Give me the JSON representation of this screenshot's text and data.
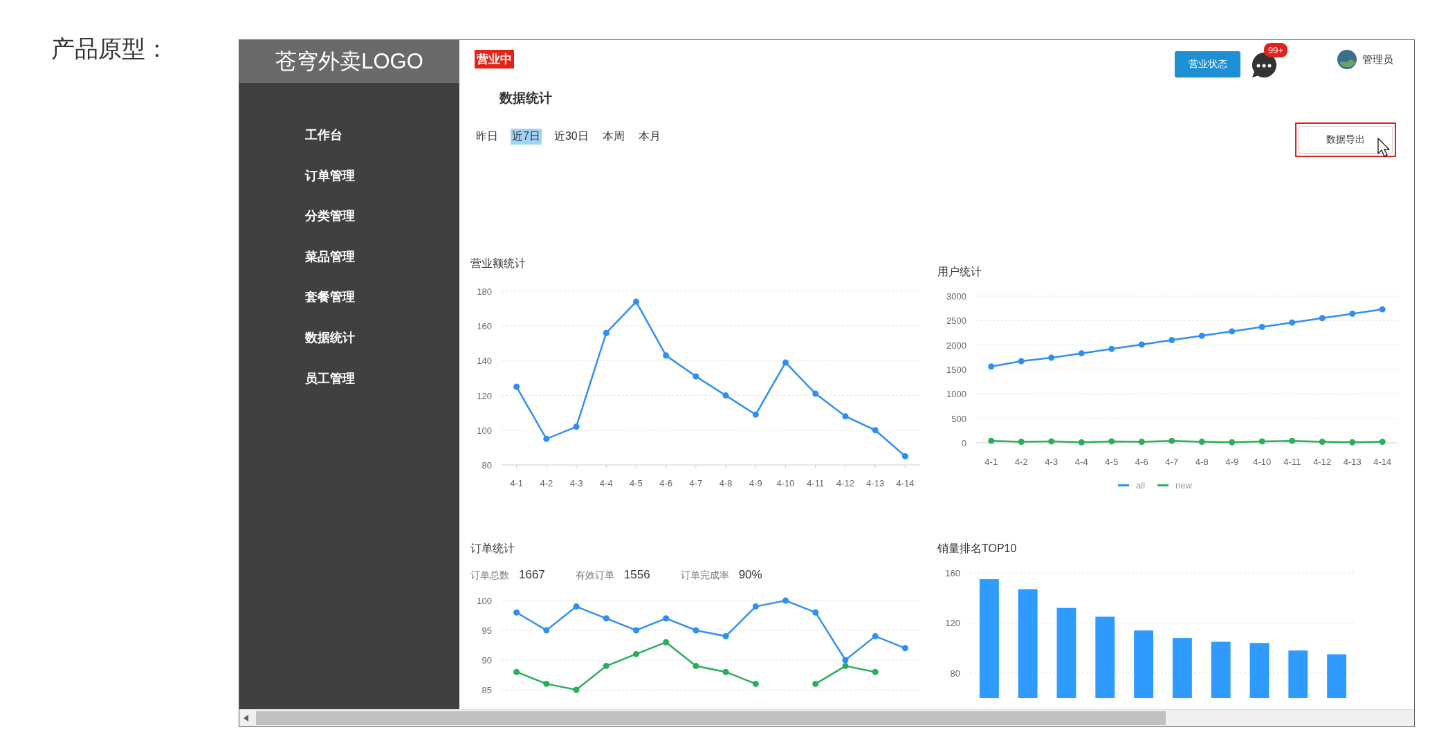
{
  "page_label": "产品原型：",
  "sidebar": {
    "logo": "苍穹外卖LOGO",
    "items": [
      "工作台",
      "订单管理",
      "分类管理",
      "菜品管理",
      "套餐管理",
      "数据统计",
      "员工管理"
    ]
  },
  "header": {
    "status_tag": "营业中",
    "status_button": "营业状态",
    "message_badge": "99+",
    "user": "管理员"
  },
  "page_title": "数据统计",
  "date_filters": [
    {
      "label": "昨日",
      "selected": false
    },
    {
      "label": "近7日",
      "selected": true
    },
    {
      "label": "近30日",
      "selected": false
    },
    {
      "label": "本周",
      "selected": false
    },
    {
      "label": "本月",
      "selected": false
    }
  ],
  "export_button": {
    "label": "数据导出",
    "highlighted": true
  },
  "revenue": {
    "title": "营业额统计",
    "chart_data": {
      "type": "line",
      "grid": true,
      "categories": [
        "4-1",
        "4-2",
        "4-3",
        "4-4",
        "4-5",
        "4-6",
        "4-7",
        "4-8",
        "4-9",
        "4-10",
        "4-11",
        "4-12",
        "4-13",
        "4-14"
      ],
      "ylim": [
        80,
        180
      ],
      "yticks": [
        80,
        100,
        120,
        140,
        160,
        180
      ],
      "series": [
        {
          "color": "#2f8ff0",
          "marker": true,
          "values": [
            125,
            95,
            102,
            156,
            174,
            143,
            131,
            120,
            109,
            139,
            121,
            108,
            100,
            85
          ]
        }
      ]
    }
  },
  "users": {
    "title": "用户统计",
    "chart_data": {
      "type": "line",
      "grid": true,
      "categories": [
        "4-1",
        "4-2",
        "4-3",
        "4-4",
        "4-5",
        "4-6",
        "4-7",
        "4-8",
        "4-9",
        "4-10",
        "4-11",
        "4-12",
        "4-13",
        "4-14"
      ],
      "ylim": [
        0,
        3000
      ],
      "yticks": [
        0,
        500,
        1000,
        1500,
        2000,
        2500,
        3000
      ],
      "series": [
        {
          "name": "all",
          "color": "#2f8ff0",
          "marker": true,
          "values": [
            1560,
            1670,
            1740,
            1830,
            1920,
            2010,
            2100,
            2190,
            2280,
            2370,
            2460,
            2550,
            2640,
            2730
          ]
        },
        {
          "name": "new",
          "color": "#2bad5c",
          "marker": true,
          "values": [
            40,
            20,
            30,
            10,
            30,
            20,
            40,
            20,
            10,
            30,
            40,
            20,
            10,
            20
          ]
        }
      ]
    }
  },
  "orders": {
    "title": "订单统计",
    "stats": [
      {
        "label": "订单总数",
        "value": "1667"
      },
      {
        "label": "有效订单",
        "value": "1556"
      },
      {
        "label": "订单完成率",
        "value": "90%"
      }
    ],
    "chart_data": {
      "type": "line",
      "grid": true,
      "ylim": [
        85,
        100
      ],
      "yticks": [
        85,
        90,
        95,
        100
      ],
      "series": [
        {
          "color": "#2f8ff0",
          "marker": true,
          "values": [
            98,
            95,
            99,
            97,
            95,
            97,
            95,
            94,
            99,
            100,
            98,
            90,
            94,
            92
          ]
        },
        {
          "color": "#2bad5c",
          "marker": true,
          "values": [
            88,
            86,
            85,
            89,
            91,
            93,
            89,
            88,
            86,
            null,
            86,
            89,
            88,
            null
          ]
        }
      ]
    }
  },
  "top10": {
    "title": "销量排名TOP10",
    "chart_data": {
      "type": "bar",
      "grid": true,
      "ylim": [
        60,
        160
      ],
      "yticks": [
        80,
        120,
        160
      ],
      "series": [
        {
          "color": "#2f9bff",
          "values": [
            155,
            147,
            132,
            125,
            114,
            108,
            105,
            104,
            98,
            95
          ]
        }
      ]
    }
  }
}
